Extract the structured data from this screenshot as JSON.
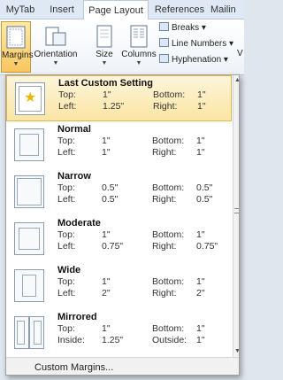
{
  "tabs": [
    {
      "label": "MyTab",
      "active": false
    },
    {
      "label": "Insert",
      "active": false
    },
    {
      "label": "Page Layout",
      "active": true
    },
    {
      "label": "References",
      "active": false
    },
    {
      "label": "Mailin",
      "active": false
    }
  ],
  "ribbon": {
    "margins_label": "Margins",
    "orientation_label": "Orientation",
    "size_label": "Size",
    "columns_label": "Columns",
    "breaks_label": "Breaks",
    "line_numbers_label": "Line Numbers",
    "hyphenation_label": "Hyphenation",
    "trailing_char": "V"
  },
  "margins_menu": {
    "items": [
      {
        "name": "Last Custom Setting",
        "labels": [
          "Top:",
          "Left:",
          "Bottom:",
          "Right:"
        ],
        "top": "1\"",
        "left": "1.25\"",
        "bottom": "1\"",
        "right": "1\"",
        "icon": "star-page-icon",
        "selected": true
      },
      {
        "name": "Normal",
        "labels": [
          "Top:",
          "Left:",
          "Bottom:",
          "Right:"
        ],
        "top": "1\"",
        "left": "1\"",
        "bottom": "1\"",
        "right": "1\"",
        "icon": "page-margins-icon"
      },
      {
        "name": "Narrow",
        "labels": [
          "Top:",
          "Left:",
          "Bottom:",
          "Right:"
        ],
        "top": "0.5\"",
        "left": "0.5\"",
        "bottom": "0.5\"",
        "right": "0.5\"",
        "icon": "page-margins-icon"
      },
      {
        "name": "Moderate",
        "labels": [
          "Top:",
          "Left:",
          "Bottom:",
          "Right:"
        ],
        "top": "1\"",
        "left": "0.75\"",
        "bottom": "1\"",
        "right": "0.75\"",
        "icon": "page-margins-icon"
      },
      {
        "name": "Wide",
        "labels": [
          "Top:",
          "Left:",
          "Bottom:",
          "Right:"
        ],
        "top": "1\"",
        "left": "2\"",
        "bottom": "1\"",
        "right": "2\"",
        "icon": "page-margins-icon"
      },
      {
        "name": "Mirrored",
        "labels": [
          "Top:",
          "Inside:",
          "Bottom:",
          "Outside:"
        ],
        "top": "1\"",
        "left": "1.25\"",
        "bottom": "1\"",
        "right": "1\"",
        "icon": "mirrored-pages-icon"
      }
    ],
    "custom_margins_label": "Custom Margins..."
  }
}
